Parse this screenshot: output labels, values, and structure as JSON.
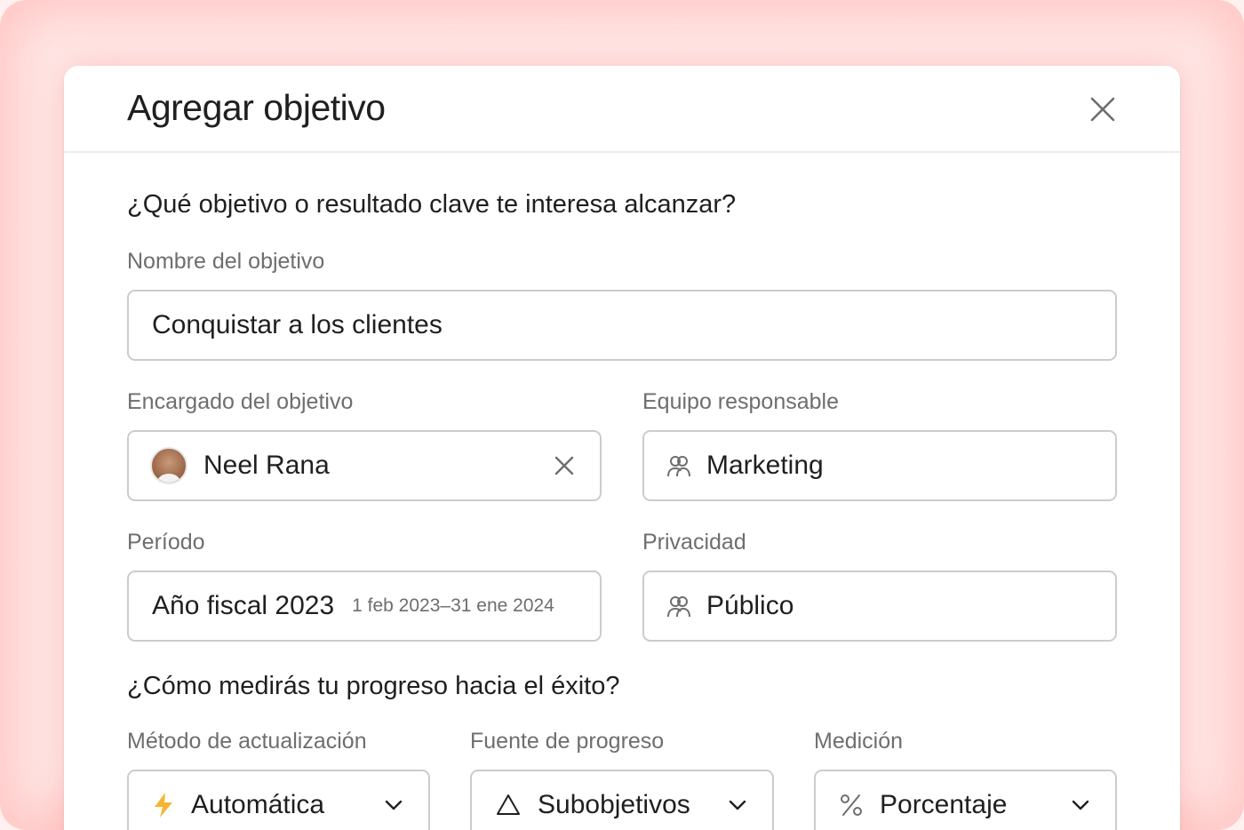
{
  "dialog": {
    "title": "Agregar objetivo"
  },
  "section1": {
    "question": "¿Qué objetivo o resultado clave te interesa alcanzar?",
    "goal_name": {
      "label": "Nombre del objetivo",
      "value": "Conquistar a los clientes"
    },
    "owner": {
      "label": "Encargado del objetivo",
      "value": "Neel Rana"
    },
    "team": {
      "label": "Equipo responsable",
      "value": "Marketing"
    },
    "period": {
      "label": "Período",
      "value": "Año fiscal 2023",
      "range": "1 feb 2023–31 ene 2024"
    },
    "privacy": {
      "label": "Privacidad",
      "value": "Público"
    }
  },
  "section2": {
    "question": "¿Cómo medirás tu progreso hacia el éxito?",
    "update_method": {
      "label": "Método de actualización",
      "value": "Automática",
      "icon": "lightning-icon"
    },
    "progress_source": {
      "label": "Fuente de progreso",
      "value": "Subobjetivos",
      "icon": "triangle-icon"
    },
    "measurement": {
      "label": "Medición",
      "value": "Porcentaje",
      "icon": "percent-icon"
    }
  },
  "colors": {
    "accent_bolt": "#f5b531",
    "text_primary": "#1e1f21",
    "text_secondary": "#6d6e6f",
    "border": "#cfcbcb"
  }
}
